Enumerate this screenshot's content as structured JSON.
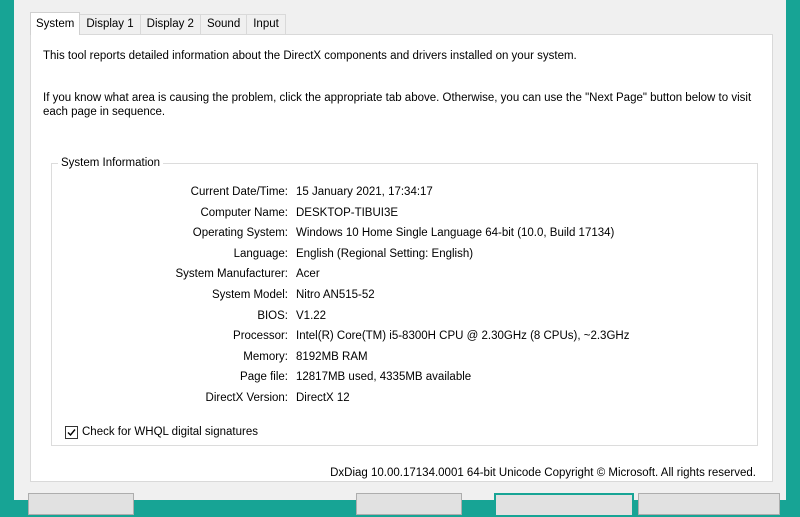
{
  "tabs": [
    "System",
    "Display 1",
    "Display 2",
    "Sound",
    "Input"
  ],
  "intro_text": "This tool reports detailed information about the DirectX components and drivers installed on your system.",
  "hint_text": "If you know what area is causing the problem, click the appropriate tab above.  Otherwise, you can use the \"Next Page\" button below to visit each page in sequence.",
  "system_info": {
    "title": "System Information",
    "rows": [
      {
        "label": "Current Date/Time:",
        "value": "15 January 2021, 17:34:17"
      },
      {
        "label": "Computer Name:",
        "value": "DESKTOP-TIBUI3E"
      },
      {
        "label": "Operating System:",
        "value": "Windows 10 Home Single Language 64-bit (10.0, Build 17134)"
      },
      {
        "label": "Language:",
        "value": "English (Regional Setting: English)"
      },
      {
        "label": "System Manufacturer:",
        "value": "Acer"
      },
      {
        "label": "System Model:",
        "value": "Nitro AN515-52"
      },
      {
        "label": "BIOS:",
        "value": "V1.22"
      },
      {
        "label": "Processor:",
        "value": "Intel(R) Core(TM) i5-8300H CPU @ 2.30GHz (8 CPUs), ~2.3GHz"
      },
      {
        "label": "Memory:",
        "value": "8192MB RAM"
      },
      {
        "label": "Page file:",
        "value": "12817MB used, 4335MB available"
      },
      {
        "label": "DirectX Version:",
        "value": "DirectX 12"
      }
    ]
  },
  "whql": {
    "label": "Check for WHQL digital signatures",
    "checked": true
  },
  "footer": "DxDiag 10.00.17134.0001 64-bit Unicode  Copyright © Microsoft. All rights reserved.",
  "colors": {
    "background": "#17a495",
    "window": "#f0f0f0",
    "panel": "#ffffff"
  }
}
